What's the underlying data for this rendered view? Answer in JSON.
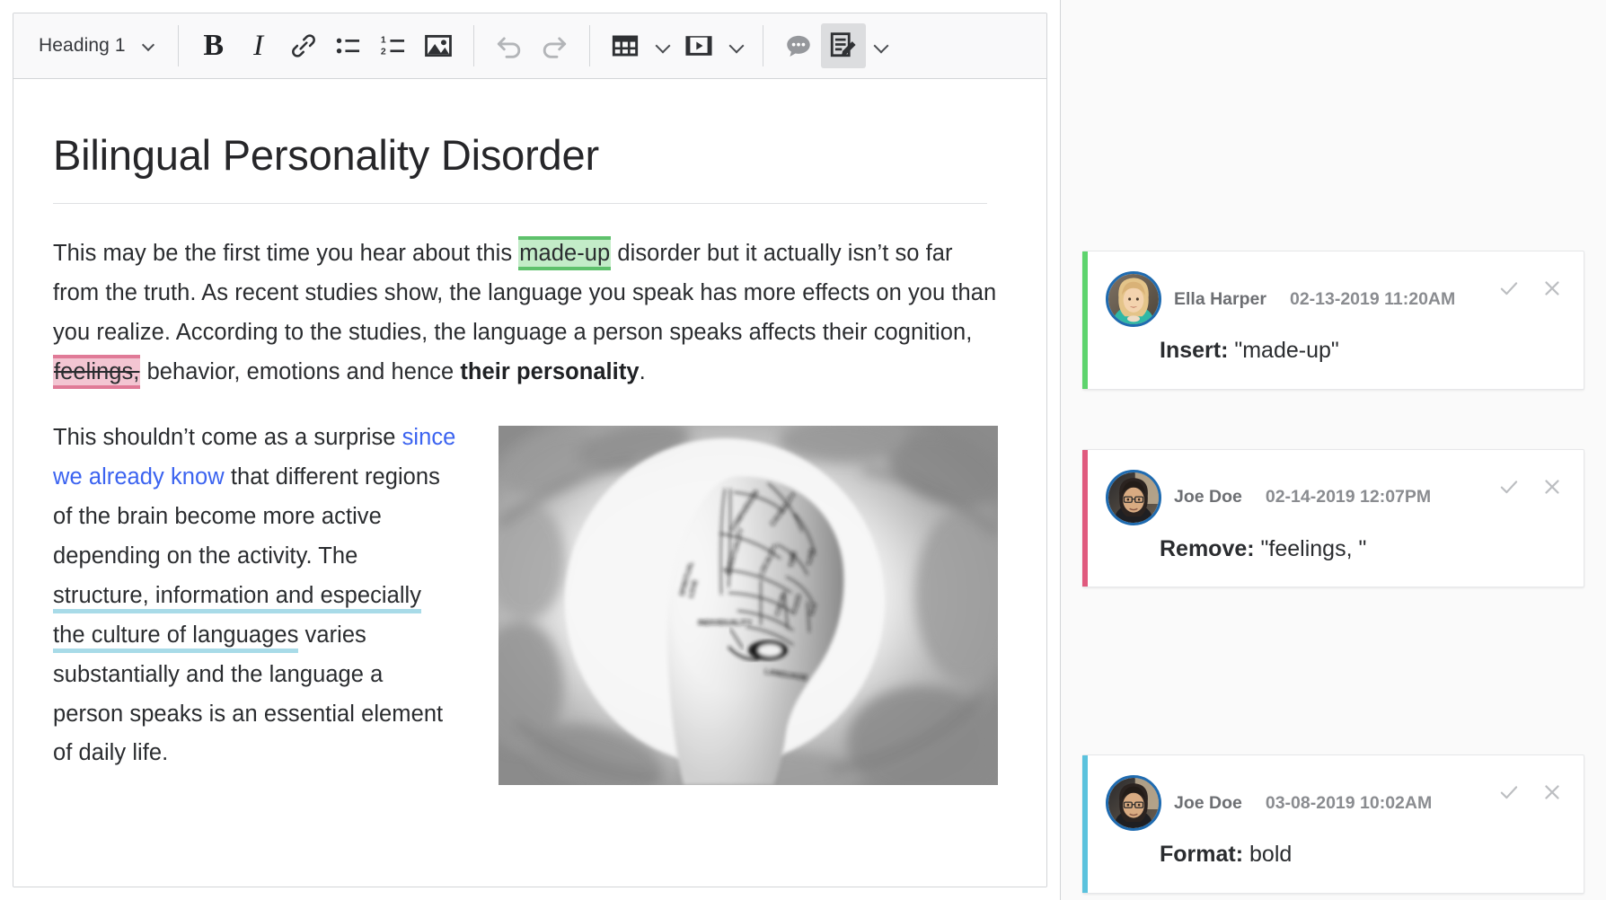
{
  "toolbar": {
    "style_select": {
      "value": "Heading 1",
      "icon": "chevron-down-icon"
    },
    "buttons": [
      {
        "name": "bold-button",
        "label": "B",
        "icon": "bold-icon"
      },
      {
        "name": "italic-button",
        "label": "I",
        "icon": "italic-icon"
      },
      {
        "name": "link-button",
        "label": "Link",
        "icon": "link-icon"
      },
      {
        "name": "bullet-list-button",
        "label": "Bulleted list",
        "icon": "bullet-list-icon"
      },
      {
        "name": "numbered-list-button",
        "label": "Numbered list",
        "icon": "numbered-list-icon"
      },
      {
        "name": "insert-image-button",
        "label": "Image",
        "icon": "image-icon"
      },
      {
        "name": "undo-button",
        "label": "Undo",
        "icon": "undo-icon"
      },
      {
        "name": "redo-button",
        "label": "Redo",
        "icon": "redo-icon"
      },
      {
        "name": "insert-table-button",
        "label": "Table",
        "icon": "table-icon"
      },
      {
        "name": "insert-media-button",
        "label": "Media",
        "icon": "video-icon"
      },
      {
        "name": "comment-button",
        "label": "Comment",
        "icon": "comment-bubble-icon"
      },
      {
        "name": "track-changes-button",
        "label": "Track changes",
        "icon": "track-changes-icon"
      }
    ]
  },
  "document": {
    "title": "Bilingual Personality Disorder",
    "paragraph1": {
      "seg1": "This may be the first time you hear about this ",
      "insert": "made-up",
      "seg2": " disorder but it actually isn’t so far from the truth. As recent studies show, the language you speak has more effects on you than you realize. According to the studies, the language a person speaks affects their cognition, ",
      "delete": "feelings,",
      "seg3": " behavior, emotions and hence ",
      "bold": "their personality",
      "seg4": "."
    },
    "paragraph2": {
      "seg1": "This shouldn’t come as a surprise ",
      "link": "since we already know",
      "seg2": " that different regions of the brain become more active depending on the activity. The ",
      "formatted": "structure, information and especially the culture of languages",
      "seg3": " varies substantially and the language a person speaks is an essential element of daily life."
    },
    "figure": {
      "name": "phrenology-head-image",
      "alt": "Grayscale photo of a phrenology head with labelled regions"
    }
  },
  "sidebar": {
    "cards": [
      {
        "type": "insert",
        "accent": "#5ed46e",
        "author": "Ella Harper",
        "timestamp": "02-13-2019 11:20AM",
        "action_label": "Insert:",
        "action_value": " \"made-up\"",
        "accept": "accept-icon",
        "reject": "reject-icon"
      },
      {
        "type": "remove",
        "accent": "#e05a7e",
        "author": "Joe Doe",
        "timestamp": "02-14-2019 12:07PM",
        "action_label": "Remove:",
        "action_value": " \"feelings, \"",
        "accept": "accept-icon",
        "reject": "reject-icon"
      },
      {
        "type": "format",
        "accent": "#5bc2dd",
        "author": "Joe Doe",
        "timestamp": "03-08-2019 10:02AM",
        "action_label": "Format:",
        "action_value": " bold",
        "accept": "accept-icon",
        "reject": "reject-icon"
      }
    ]
  },
  "colors": {
    "insert_highlight": "#c3ecc8",
    "insert_border": "#5ec16c",
    "delete_highlight": "#f3c5d2",
    "delete_border": "#e07a97",
    "format_underline": "#a8dbe8",
    "link": "#3b63f0",
    "avatar_ring": "#1f6bb0"
  }
}
